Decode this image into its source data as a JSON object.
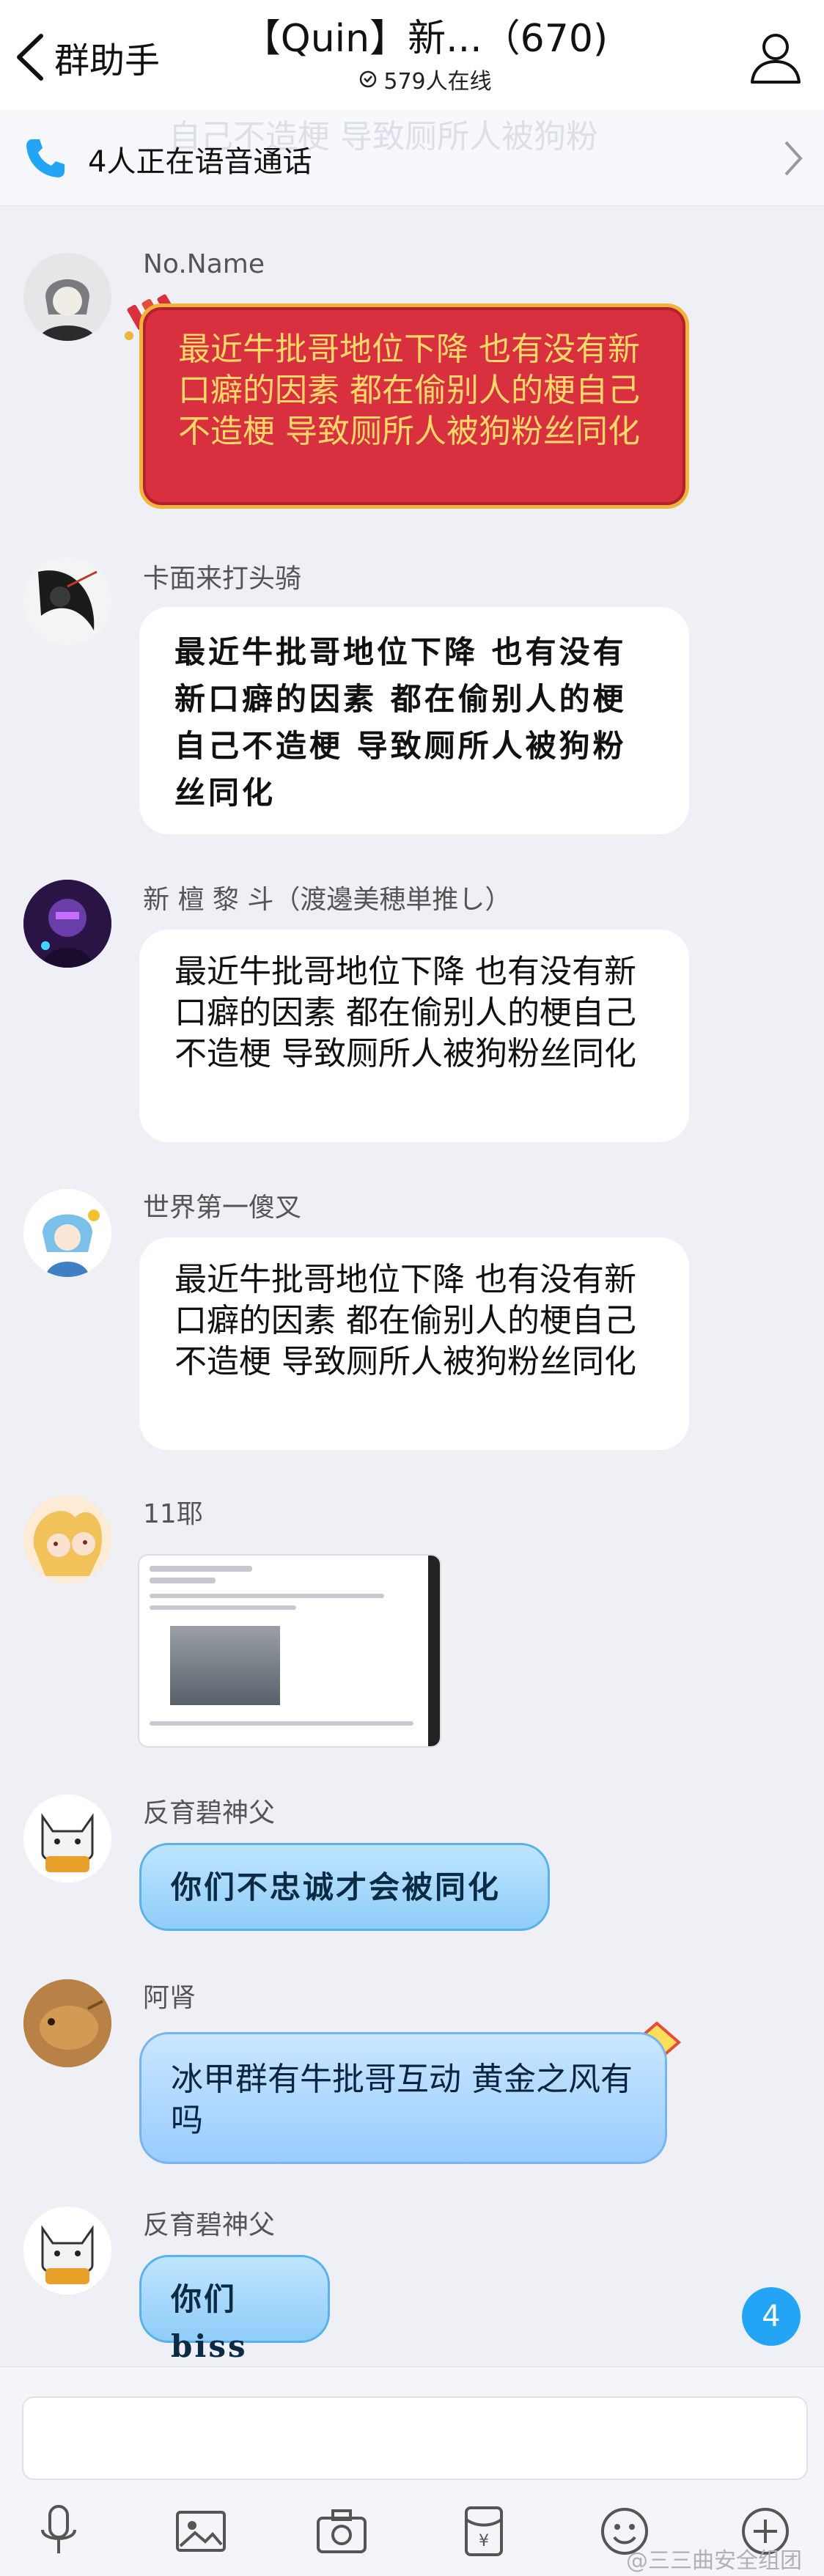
{
  "header": {
    "back_label": "群助手",
    "title": "【Quin】新...（670)",
    "online": "579人在线"
  },
  "voice_bar": {
    "text": "4人正在语音通话",
    "ghost_text": "自己不造梗 导致厕所人被狗粉"
  },
  "messages": [
    {
      "sender": "No.Name",
      "type": "text",
      "style": "red",
      "text": "最近牛批哥地位下降 也有没有新口癖的因素 都在偷别人的梗自己不造梗 导致厕所人被狗粉丝同化"
    },
    {
      "sender": "卡面来打头骑",
      "type": "text",
      "style": "hand",
      "text": "最近牛批哥地位下降 也有没有新口癖的因素 都在偷别人的梗自己不造梗 导致厕所人被狗粉丝同化"
    },
    {
      "sender": "新 檀 黎 斗（渡邊美穂単推し）",
      "type": "text",
      "style": "plain",
      "text": "最近牛批哥地位下降 也有没有新口癖的因素 都在偷别人的梗自己不造梗 导致厕所人被狗粉丝同化"
    },
    {
      "sender": "世界第一傻叉",
      "type": "text",
      "style": "plain",
      "text": "最近牛批哥地位下降 也有没有新口癖的因素 都在偷别人的梗自己不造梗 导致厕所人被狗粉丝同化"
    },
    {
      "sender": "11耶",
      "type": "image"
    },
    {
      "sender": "反育碧神父",
      "type": "text",
      "style": "blue",
      "text": "你们不忠诚才会被同化"
    },
    {
      "sender": "阿肾",
      "type": "text",
      "style": "blue2",
      "text": "冰甲群有牛批哥互动 黄金之风有吗"
    },
    {
      "sender": "反育碧神父",
      "type": "text",
      "style": "blue",
      "text": "你们biss"
    }
  ],
  "unread_count": "4",
  "input": {
    "placeholder": ""
  },
  "toolbar": {
    "icons": [
      "microphone-icon",
      "image-icon",
      "camera-icon",
      "red-packet-icon",
      "emoji-icon",
      "plus-icon"
    ]
  },
  "watermark": "@三三曲安全组团",
  "colors": {
    "accent": "#23a4f5",
    "red_bubble": "#d8303e",
    "red_bubble_text": "#ffd86a",
    "background": "#eef0f5"
  }
}
